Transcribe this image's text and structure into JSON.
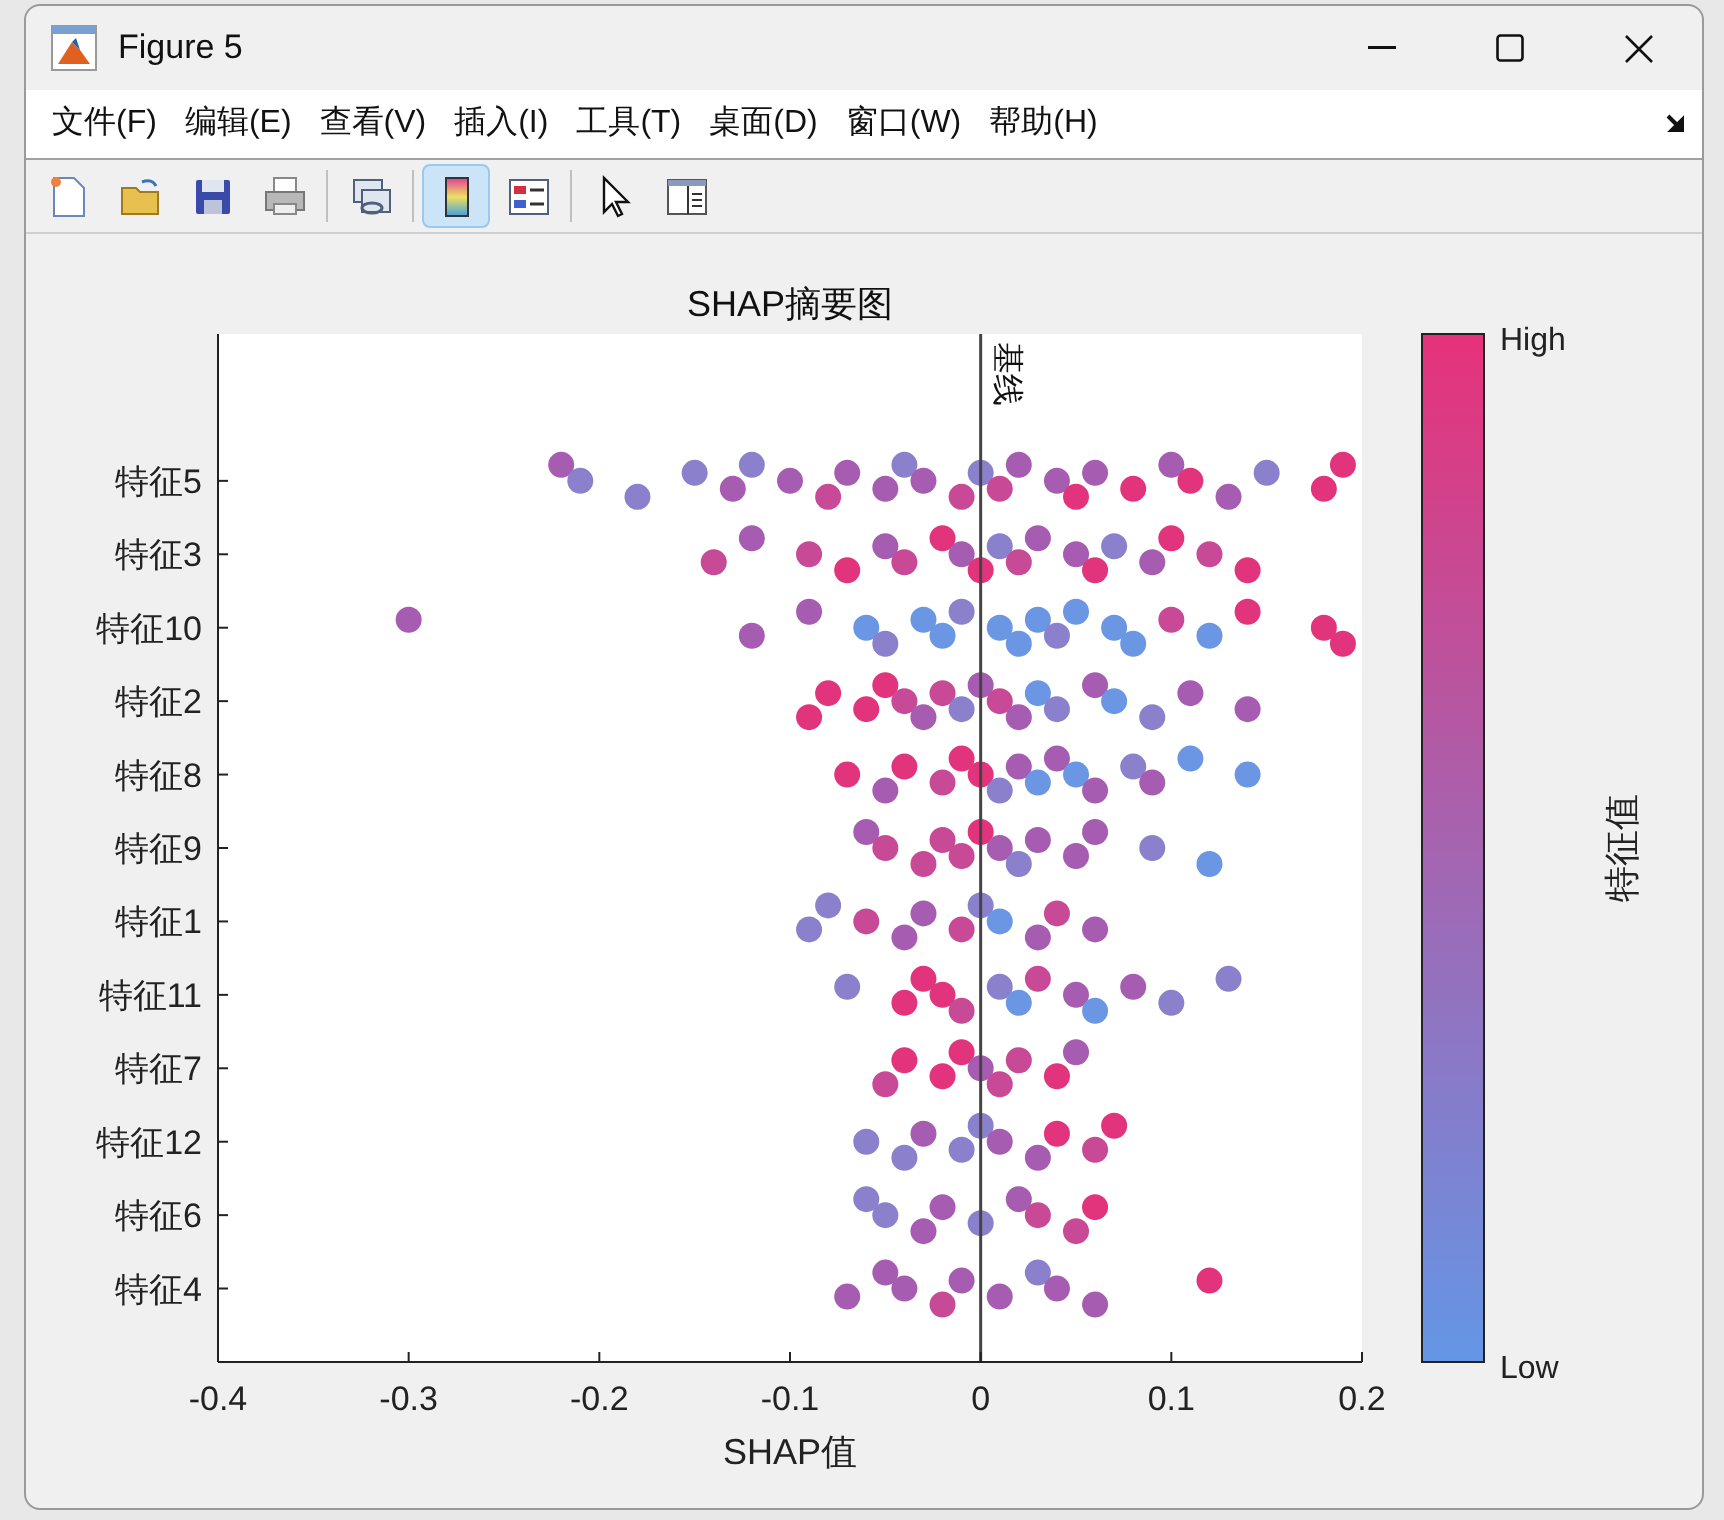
{
  "window": {
    "title": "Figure 5"
  },
  "menu": [
    "文件(F)",
    "编辑(E)",
    "查看(V)",
    "插入(I)",
    "工具(T)",
    "桌面(D)",
    "窗口(W)",
    "帮助(H)"
  ],
  "toolbar": [
    {
      "kind": "new",
      "selected": false
    },
    {
      "kind": "open",
      "selected": false
    },
    {
      "kind": "save",
      "selected": false
    },
    {
      "kind": "print",
      "selected": false
    },
    {
      "kind": "link",
      "selected": false
    },
    {
      "kind": "colorbar",
      "selected": true
    },
    {
      "kind": "legend",
      "selected": false
    },
    {
      "kind": "pointer",
      "selected": false
    },
    {
      "kind": "inspector",
      "selected": false
    }
  ],
  "chart_data": {
    "type": "scatter",
    "orientation": "horizontal",
    "title": "SHAP摘要图",
    "xlabel": "SHAP值",
    "xlim": [
      -0.4,
      0.2
    ],
    "xticks": [
      -0.4,
      -0.3,
      -0.2,
      -0.1,
      0,
      0.1,
      0.2
    ],
    "categories": [
      "特征5",
      "特征3",
      "特征10",
      "特征2",
      "特征8",
      "特征9",
      "特征1",
      "特征11",
      "特征7",
      "特征12",
      "特征6",
      "特征4"
    ],
    "series": [
      {
        "values": [
          -0.22,
          -0.14,
          -0.3,
          -0.09,
          -0.07,
          -0.06,
          -0.09,
          -0.07,
          -0.05,
          -0.06,
          -0.06,
          -0.07
        ],
        "colors": [
          "#a65cb0",
          "#c84a96",
          "#a65cb0",
          "#e2347c",
          "#e2347c",
          "#a65cb0",
          "#8a80cc",
          "#8a80cc",
          "#c84a96",
          "#8a80cc",
          "#8a80cc",
          "#a65cb0"
        ]
      },
      {
        "values": [
          -0.21,
          -0.12,
          -0.12,
          -0.08,
          -0.05,
          -0.05,
          -0.08,
          -0.04,
          -0.04,
          -0.04,
          -0.05,
          -0.05
        ],
        "colors": [
          "#8a80cc",
          "#a65cb0",
          "#a65cb0",
          "#e2347c",
          "#a65cb0",
          "#c84a96",
          "#8a80cc",
          "#e2347c",
          "#e2347c",
          "#8a80cc",
          "#8a80cc",
          "#a65cb0"
        ]
      },
      {
        "values": [
          -0.18,
          -0.09,
          -0.09,
          -0.06,
          -0.04,
          -0.03,
          -0.06,
          -0.03,
          -0.02,
          -0.03,
          -0.03,
          -0.04
        ],
        "colors": [
          "#8a80cc",
          "#c84a96",
          "#a65cb0",
          "#e2347c",
          "#e2347c",
          "#c84a96",
          "#c84a96",
          "#e2347c",
          "#e2347c",
          "#a65cb0",
          "#a65cb0",
          "#a65cb0"
        ]
      },
      {
        "values": [
          -0.15,
          -0.07,
          -0.06,
          -0.05,
          -0.02,
          -0.02,
          -0.04,
          -0.02,
          -0.01,
          -0.01,
          -0.02,
          -0.02
        ],
        "colors": [
          "#8a80cc",
          "#e2347c",
          "#6a96e4",
          "#e2347c",
          "#c84a96",
          "#c84a96",
          "#a65cb0",
          "#e2347c",
          "#e2347c",
          "#8a80cc",
          "#a65cb0",
          "#c84a96"
        ]
      },
      {
        "values": [
          -0.13,
          -0.05,
          -0.05,
          -0.04,
          -0.01,
          -0.01,
          -0.03,
          -0.01,
          0,
          0,
          0,
          -0.01
        ],
        "colors": [
          "#a65cb0",
          "#a65cb0",
          "#8a80cc",
          "#c84a96",
          "#e2347c",
          "#c84a96",
          "#a65cb0",
          "#c84a96",
          "#a65cb0",
          "#8a80cc",
          "#8a80cc",
          "#a65cb0"
        ]
      },
      {
        "values": [
          -0.12,
          -0.04,
          -0.03,
          -0.03,
          0,
          0,
          -0.01,
          0.01,
          0.01,
          0.01,
          0.02,
          0.01
        ],
        "colors": [
          "#8a80cc",
          "#c84a96",
          "#6a96e4",
          "#a65cb0",
          "#e2347c",
          "#e2347c",
          "#c84a96",
          "#8a80cc",
          "#c84a96",
          "#a65cb0",
          "#a65cb0",
          "#a65cb0"
        ]
      },
      {
        "values": [
          -0.1,
          -0.02,
          -0.02,
          -0.02,
          0.01,
          0.01,
          0,
          0.02,
          0.02,
          0.03,
          0.03,
          0.03
        ],
        "colors": [
          "#a65cb0",
          "#e2347c",
          "#6a96e4",
          "#c84a96",
          "#8a80cc",
          "#a65cb0",
          "#8a80cc",
          "#6a96e4",
          "#c84a96",
          "#a65cb0",
          "#c84a96",
          "#8a80cc"
        ]
      },
      {
        "values": [
          -0.08,
          -0.01,
          -0.01,
          -0.01,
          0.02,
          0.02,
          0.01,
          0.03,
          0.04,
          0.04,
          0.05,
          0.04
        ],
        "colors": [
          "#c84a96",
          "#a65cb0",
          "#8a80cc",
          "#8a80cc",
          "#a65cb0",
          "#8a80cc",
          "#6a96e4",
          "#c84a96",
          "#e2347c",
          "#e2347c",
          "#c84a96",
          "#a65cb0"
        ]
      },
      {
        "values": [
          -0.07,
          0,
          0.01,
          0,
          0.03,
          0.03,
          0.03,
          0.05,
          0.05,
          0.06,
          0.06,
          0.06
        ],
        "colors": [
          "#a65cb0",
          "#e2347c",
          "#6a96e4",
          "#a65cb0",
          "#6a96e4",
          "#a65cb0",
          "#a65cb0",
          "#a65cb0",
          "#a65cb0",
          "#c84a96",
          "#e2347c",
          "#a65cb0"
        ]
      },
      {
        "values": [
          -0.05,
          0.01,
          0.02,
          0.01,
          0.04,
          0.05,
          0.04,
          0.06,
          null,
          0.07,
          null,
          0.12
        ],
        "colors": [
          "#a65cb0",
          "#8a80cc",
          "#6a96e4",
          "#c84a96",
          "#a65cb0",
          "#a65cb0",
          "#c84a96",
          "#6a96e4",
          null,
          "#e2347c",
          null,
          "#e2347c"
        ]
      },
      {
        "values": [
          -0.04,
          0.02,
          0.03,
          0.02,
          0.05,
          0.06,
          0.06,
          0.08,
          null,
          null,
          null,
          null
        ],
        "colors": [
          "#8a80cc",
          "#c84a96",
          "#6a96e4",
          "#a65cb0",
          "#6a96e4",
          "#a65cb0",
          "#a65cb0",
          "#a65cb0",
          null,
          null,
          null,
          null
        ]
      },
      {
        "values": [
          -0.03,
          0.03,
          0.04,
          0.03,
          0.06,
          0.09,
          null,
          0.1,
          null,
          null,
          null,
          null
        ],
        "colors": [
          "#a65cb0",
          "#a65cb0",
          "#8a80cc",
          "#6a96e4",
          "#a65cb0",
          "#8a80cc",
          null,
          "#8a80cc",
          null,
          null,
          null,
          null
        ]
      },
      {
        "values": [
          -0.01,
          0.05,
          0.05,
          0.04,
          0.08,
          0.12,
          null,
          0.13,
          null,
          null,
          null,
          null
        ],
        "colors": [
          "#c84a96",
          "#a65cb0",
          "#6a96e4",
          "#8a80cc",
          "#8a80cc",
          "#6a96e4",
          null,
          "#8a80cc",
          null,
          null,
          null,
          null
        ]
      },
      {
        "values": [
          0,
          0.06,
          0.07,
          0.06,
          0.09,
          null,
          null,
          null,
          null,
          null,
          null,
          null
        ],
        "colors": [
          "#8a80cc",
          "#e2347c",
          "#6a96e4",
          "#a65cb0",
          "#a65cb0",
          null,
          null,
          null,
          null,
          null,
          null,
          null
        ]
      },
      {
        "values": [
          0.01,
          0.07,
          0.08,
          0.07,
          0.11,
          null,
          null,
          null,
          null,
          null,
          null,
          null
        ],
        "colors": [
          "#c84a96",
          "#8a80cc",
          "#6a96e4",
          "#6a96e4",
          "#6a96e4",
          null,
          null,
          null,
          null,
          null,
          null,
          null
        ]
      },
      {
        "values": [
          0.02,
          0.09,
          0.1,
          0.09,
          0.14,
          null,
          null,
          null,
          null,
          null,
          null,
          null
        ],
        "colors": [
          "#a65cb0",
          "#a65cb0",
          "#c84a96",
          "#8a80cc",
          "#6a96e4",
          null,
          null,
          null,
          null,
          null,
          null,
          null
        ]
      },
      {
        "values": [
          0.04,
          0.1,
          0.12,
          0.11,
          null,
          null,
          null,
          null,
          null,
          null,
          null,
          null
        ],
        "colors": [
          "#a65cb0",
          "#e2347c",
          "#6a96e4",
          "#a65cb0",
          null,
          null,
          null,
          null,
          null,
          null,
          null,
          null
        ]
      },
      {
        "values": [
          0.05,
          0.12,
          0.14,
          0.14,
          null,
          null,
          null,
          null,
          null,
          null,
          null,
          null
        ],
        "colors": [
          "#e2347c",
          "#c84a96",
          "#e2347c",
          "#a65cb0",
          null,
          null,
          null,
          null,
          null,
          null,
          null,
          null
        ]
      },
      {
        "values": [
          0.06,
          0.14,
          0.18,
          null,
          null,
          null,
          null,
          null,
          null,
          null,
          null,
          null
        ],
        "colors": [
          "#a65cb0",
          "#e2347c",
          "#e2347c",
          null,
          null,
          null,
          null,
          null,
          null,
          null,
          null,
          null
        ]
      },
      {
        "values": [
          0.08,
          null,
          0.19,
          null,
          null,
          null,
          null,
          null,
          null,
          null,
          null,
          null
        ],
        "colors": [
          "#e2347c",
          null,
          "#e2347c",
          null,
          null,
          null,
          null,
          null,
          null,
          null,
          null,
          null
        ]
      },
      {
        "values": [
          0.1,
          null,
          null,
          null,
          null,
          null,
          null,
          null,
          null,
          null,
          null,
          null
        ],
        "colors": [
          "#a65cb0",
          null,
          null,
          null,
          null,
          null,
          null,
          null,
          null,
          null,
          null,
          null
        ]
      },
      {
        "values": [
          0.11,
          null,
          null,
          null,
          null,
          null,
          null,
          null,
          null,
          null,
          null,
          null
        ],
        "colors": [
          "#e2347c",
          null,
          null,
          null,
          null,
          null,
          null,
          null,
          null,
          null,
          null,
          null
        ]
      },
      {
        "values": [
          0.13,
          null,
          null,
          null,
          null,
          null,
          null,
          null,
          null,
          null,
          null,
          null
        ],
        "colors": [
          "#a65cb0",
          null,
          null,
          null,
          null,
          null,
          null,
          null,
          null,
          null,
          null,
          null
        ]
      },
      {
        "values": [
          0.15,
          null,
          null,
          null,
          null,
          null,
          null,
          null,
          null,
          null,
          null,
          null
        ],
        "colors": [
          "#8a80cc",
          null,
          null,
          null,
          null,
          null,
          null,
          null,
          null,
          null,
          null,
          null
        ]
      },
      {
        "values": [
          0.18,
          null,
          null,
          null,
          null,
          null,
          null,
          null,
          null,
          null,
          null,
          null
        ],
        "colors": [
          "#e2347c",
          null,
          null,
          null,
          null,
          null,
          null,
          null,
          null,
          null,
          null,
          null
        ]
      },
      {
        "values": [
          0.19,
          null,
          null,
          null,
          null,
          null,
          null,
          null,
          null,
          null,
          null,
          null
        ],
        "colors": [
          "#e2347c",
          null,
          null,
          null,
          null,
          null,
          null,
          null,
          null,
          null,
          null,
          null
        ]
      }
    ],
    "annotations": [
      "基线"
    ]
  },
  "colorbar": {
    "label": "特征值",
    "high": "High",
    "low": "Low"
  }
}
